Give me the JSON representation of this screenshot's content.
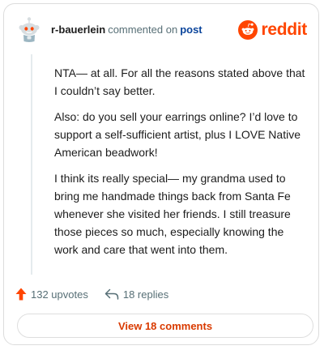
{
  "comment": {
    "username": "r-bauerlein",
    "action_text": "commented on",
    "post_link_label": "post",
    "paragraphs": [
      "NTA— at all. For all the reasons stated above that I couldn’t say better.",
      "Also: do you sell your earrings online? I’d love to support a self-sufficient artist, plus I LOVE Native American beadwork!",
      "I think its really special— my grandma used to bring me handmade things back from Santa Fe whenever she visited her friends. I still treasure those pieces so much, especially knowing the work and care that went into them."
    ]
  },
  "brand": {
    "wordmark": "reddit",
    "icon": "reddit-snoo-icon",
    "color": "#ff4500"
  },
  "footer": {
    "upvotes_label": "132 upvotes",
    "replies_label": "18 replies",
    "upvote_icon": "upvote-arrow-icon",
    "reply_icon": "reply-arrow-icon",
    "upvote_color": "#ff4500"
  },
  "view_comments_label": "View 18 comments"
}
